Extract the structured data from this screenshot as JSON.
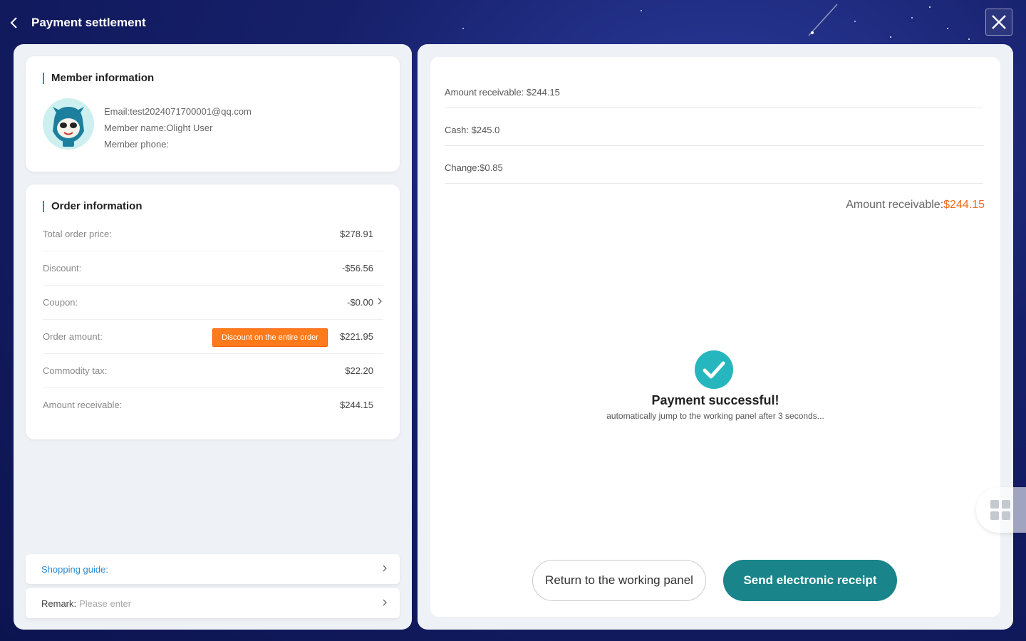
{
  "header": {
    "title": "Payment settlement"
  },
  "member": {
    "section_title": "Member information",
    "email": "Email:test2024071700001@qq.com",
    "name": "Member name:Olight User",
    "phone": "Member phone:"
  },
  "order": {
    "section_title": "Order information",
    "rows": [
      {
        "label": "Total order price:",
        "value": "$278.91"
      },
      {
        "label": "Discount:",
        "value": "-$56.56"
      },
      {
        "label": "Coupon:",
        "value": "-$0.00"
      },
      {
        "label": "Order amount:",
        "value": "$221.95",
        "badge": "Discount on the entire order"
      },
      {
        "label": "Commodity tax:",
        "value": "$22.20"
      },
      {
        "label": "Amount receivable:",
        "value": "$244.15"
      }
    ]
  },
  "bottom": {
    "guide_label": "Shopping guide:",
    "remark_label": "Remark:",
    "remark_placeholder": "Please enter"
  },
  "payment": {
    "amount_receivable": "Amount receivable:  $244.15",
    "cash": "Cash:  $245.0",
    "change": "Change:$0.85",
    "summary_label": "Amount receivable:",
    "summary_value": "$244.15",
    "success_title": "Payment successful!",
    "success_sub": "automatically jump to the working panel after 3 seconds...",
    "btn_return": "Return to the working panel",
    "btn_send": "Send electronic receipt"
  },
  "colors": {
    "accent_teal": "#19848a",
    "success_teal": "#26b6bd",
    "orange": "#ff7a1a",
    "link_blue": "#2a8bd8"
  }
}
